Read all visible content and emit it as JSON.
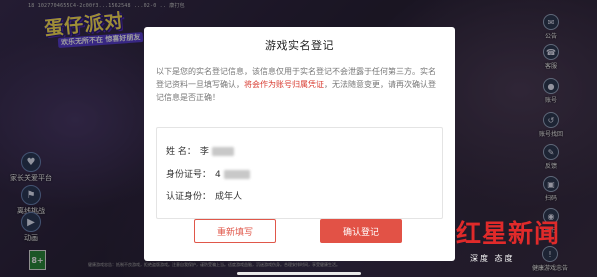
{
  "status_line": "18 1027704655C4-2c00f3...1562548 ...02-0 .. 康打包",
  "game": {
    "logo_main": "蛋仔派对",
    "logo_sub": "欢乐无所不在  惊喜好朋友",
    "left_buttons": [
      {
        "label": "家长关爱平台",
        "icon": "parent-care-icon"
      },
      {
        "label": "离线挑战",
        "icon": "offline-challenge-icon"
      },
      {
        "label": "动画",
        "icon": "animation-icon"
      }
    ],
    "age_badge": "8+",
    "right_buttons": [
      {
        "label": "公告",
        "icon": "announcement-icon"
      },
      {
        "label": "客服",
        "icon": "customer-service-icon"
      },
      {
        "label": "账号",
        "icon": "account-icon"
      },
      {
        "label": "账号找回",
        "icon": "account-recovery-icon"
      },
      {
        "label": "反馈",
        "icon": "feedback-icon"
      },
      {
        "label": "扫码",
        "icon": "scan-icon"
      },
      {
        "label": "蛋仔",
        "icon": "eggy-icon"
      },
      {
        "label": "健康游戏忠告",
        "icon": "health-notice-icon"
      }
    ],
    "footer_text": "健康游戏忠告：抵制不良游戏，拒绝盗版游戏。注意自我保护，谨防受骗上当。适度游戏益脑，沉迷游戏伤身。合理安排时间，享受健康生活。"
  },
  "watermark": {
    "title": "红星新闻",
    "subtitle": "深度 态度"
  },
  "modal": {
    "title": "游戏实名登记",
    "desc_before": "以下是您的实名登记信息，该信息仅用于实名登记不会泄露于任何第三方。实名登记资料一旦填写确认，",
    "desc_highlight": "将会作为账号归属凭证",
    "desc_after": "，无法随意变更，请再次确认登记信息是否正确！",
    "fields": {
      "name_label": "姓    名：",
      "name_value": "李",
      "id_label": "身份证号：",
      "id_value": "4",
      "type_label": "认证身份：",
      "type_value": "成年人"
    },
    "redo_label": "重新填写",
    "confirm_label": "确认登记"
  },
  "colors": {
    "accent": "#e25246",
    "highlight_text": "#d83a2f",
    "watermark_red": "#e02a2a"
  }
}
